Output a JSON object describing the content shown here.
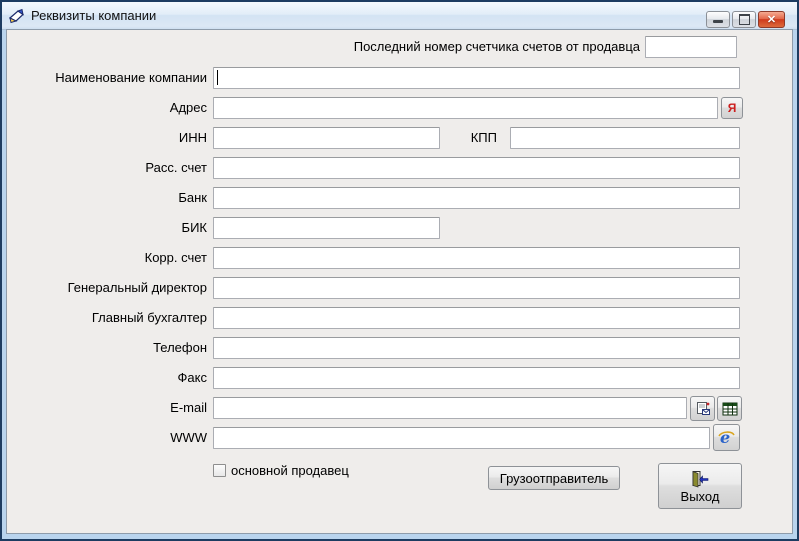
{
  "window": {
    "title": "Реквизиты компании",
    "icon": "signing-hand-icon",
    "close_glyph": "✕"
  },
  "form": {
    "seller_counter": {
      "label": "Последний номер счетчика счетов от продавца",
      "value": ""
    },
    "company_name": {
      "label": "Наименование компании",
      "value": ""
    },
    "address": {
      "label": "Адрес",
      "value": "",
      "yandex_button": "Я"
    },
    "inn": {
      "label": "ИНН",
      "value": ""
    },
    "kpp": {
      "label": "КПП",
      "value": ""
    },
    "settlement_account": {
      "label": "Расс. счет",
      "value": ""
    },
    "bank": {
      "label": "Банк",
      "value": ""
    },
    "bik": {
      "label": "БИК",
      "value": ""
    },
    "corr_account": {
      "label": "Корр. счет",
      "value": ""
    },
    "general_director": {
      "label": "Генеральный директор",
      "value": ""
    },
    "chief_accountant": {
      "label": "Главный бухгалтер",
      "value": ""
    },
    "phone": {
      "label": "Телефон",
      "value": ""
    },
    "fax": {
      "label": "Факс",
      "value": ""
    },
    "email": {
      "label": "E-mail",
      "value": ""
    },
    "www": {
      "label": "WWW",
      "value": ""
    }
  },
  "checkbox": {
    "label": "основной продавец",
    "checked": false
  },
  "buttons": {
    "consignor": "Грузоотправитель",
    "exit": "Выход"
  },
  "icons": {
    "email_compose": "compose-mail-icon",
    "email_table": "address-table-icon",
    "www_browser": "internet-explorer-icon",
    "exit_door": "exit-door-icon"
  },
  "colors": {
    "frame_blue": "#b9d4ee",
    "close_red": "#ce3a1c",
    "yandex_red": "#cc1f1f",
    "ie_blue": "#2b63c9",
    "exit_arrow_blue": "#2233bb",
    "client_bg": "#efedeb"
  }
}
